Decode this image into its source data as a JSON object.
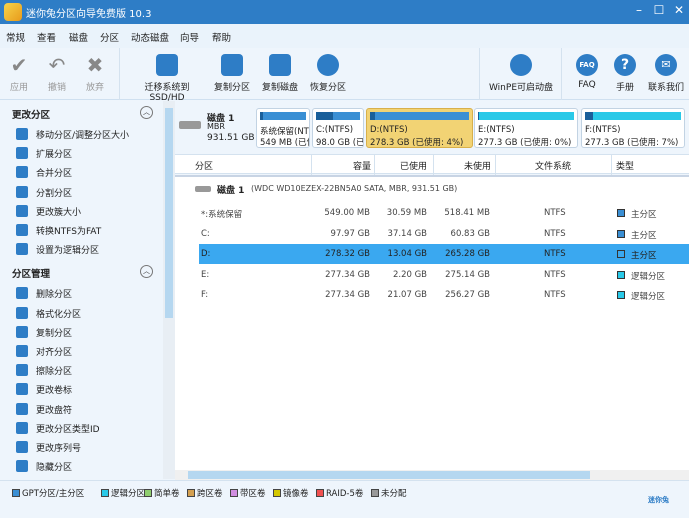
{
  "app": {
    "title": "迷你兔分区向导免费版 10.3",
    "window_controls": [
      "minimize",
      "maximize",
      "close"
    ]
  },
  "menu": [
    "常规",
    "查看",
    "磁盘",
    "分区",
    "动态磁盘",
    "向导",
    "帮助"
  ],
  "toolbar": {
    "apply": "应用",
    "undo": "撤销",
    "discard": "放弃",
    "migrate": "迁移系统到SSD/HD",
    "copy_partition": "复制分区",
    "copy_disk": "复制磁盘",
    "recover_partition": "恢复分区",
    "winpe": "WinPE可启动盘",
    "faq": "FAQ",
    "manual": "手册",
    "contact": "联系我们"
  },
  "sidebar": {
    "sections": [
      {
        "title": "更改分区",
        "items": [
          "移动分区/调整分区大小",
          "扩展分区",
          "合并分区",
          "分割分区",
          "更改簇大小",
          "转换NTFS为FAT",
          "设置为逻辑分区"
        ]
      },
      {
        "title": "分区管理",
        "items": [
          "删除分区",
          "格式化分区",
          "复制分区",
          "对齐分区",
          "擦除分区",
          "更改卷标",
          "更改盘符",
          "更改分区类型ID",
          "更改序列号",
          "隐藏分区",
          "设置为活动分区"
        ]
      }
    ]
  },
  "diskmap": {
    "disk": {
      "name": "磁盘 1",
      "scheme": "MBR",
      "size": "931.51 GB"
    },
    "partitions": [
      {
        "line1": "系统保留(NTFS)",
        "line2": "549 MB (已使用: 5%)",
        "used": 0.06,
        "color": "#3a8fd4",
        "selected": false
      },
      {
        "line1": "C:(NTFS)",
        "line2": "98.0 GB (已使用: 37%)",
        "used": 0.38,
        "color": "#3a8fd4",
        "selected": false
      },
      {
        "line1": "D:(NTFS)",
        "line2": "278.3 GB (已使用: 4%)",
        "used": 0.05,
        "color": "#3a8fd4",
        "selected": true
      },
      {
        "line1": "E:(NTFS)",
        "line2": "277.3 GB (已使用: 0%)",
        "used": 0.01,
        "color": "#29c9e8",
        "selected": false
      },
      {
        "line1": "F:(NTFS)",
        "line2": "277.3 GB (已使用: 7%)",
        "used": 0.08,
        "color": "#29c9e8",
        "selected": false
      }
    ]
  },
  "table": {
    "headers": [
      "分区",
      "容量",
      "已使用",
      "未使用",
      "文件系统",
      "类型"
    ],
    "disk_row": {
      "name": "磁盘 1",
      "detail": "(WDC WD10EZEX-22BN5A0 SATA, MBR, 931.51 GB)"
    },
    "rows": [
      {
        "name": "*:系统保留",
        "capacity": "549.00 MB",
        "used": "30.59 MB",
        "free": "518.41 MB",
        "fs": "NTFS",
        "type": "主分区",
        "color": "#3a8fd4"
      },
      {
        "name": "C:",
        "capacity": "97.97 GB",
        "used": "37.14 GB",
        "free": "60.83 GB",
        "fs": "NTFS",
        "type": "主分区",
        "color": "#3a8fd4"
      },
      {
        "name": "D:",
        "capacity": "278.32 GB",
        "used": "13.04 GB",
        "free": "265.28 GB",
        "fs": "NTFS",
        "type": "主分区",
        "color": "#3a8fd4",
        "selected": true
      },
      {
        "name": "E:",
        "capacity": "277.34 GB",
        "used": "2.20 GB",
        "free": "275.14 GB",
        "fs": "NTFS",
        "type": "逻辑分区",
        "color": "#29c9e8"
      },
      {
        "name": "F:",
        "capacity": "277.34 GB",
        "used": "21.07 GB",
        "free": "256.27 GB",
        "fs": "NTFS",
        "type": "逻辑分区",
        "color": "#29c9e8"
      }
    ]
  },
  "legend": [
    {
      "label": "GPT分区/主分区",
      "color": "#3a8fd4"
    },
    {
      "label": "逻辑分区",
      "color": "#29c9e8"
    },
    {
      "label": "简单卷",
      "color": "#8fce6f"
    },
    {
      "label": "跨区卷",
      "color": "#d4a050"
    },
    {
      "label": "带区卷",
      "color": "#d08ee0"
    },
    {
      "label": "镜像卷",
      "color": "#d4c800"
    },
    {
      "label": "RAID-5卷",
      "color": "#f05050"
    },
    {
      "label": "未分配",
      "color": "#999999"
    }
  ],
  "brand": "迷你兔"
}
